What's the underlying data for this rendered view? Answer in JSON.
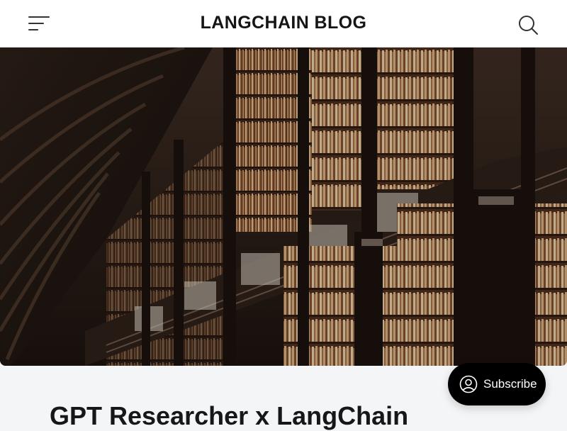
{
  "header": {
    "site_title": "LANGCHAIN BLOG",
    "menu_icon": "hamburger-menu-icon",
    "search_icon": "search-icon"
  },
  "hero": {
    "image": "library-bookshelves-photo"
  },
  "post": {
    "title": "GPT Researcher x LangChain"
  },
  "subscribe": {
    "label": "Subscribe",
    "icon": "user-circle-icon"
  },
  "colors": {
    "page_background": "#f4f5f7",
    "header_background": "#ffffff",
    "text": "#15171a",
    "subscribe_background": "#000000",
    "subscribe_text": "#ffffff"
  }
}
